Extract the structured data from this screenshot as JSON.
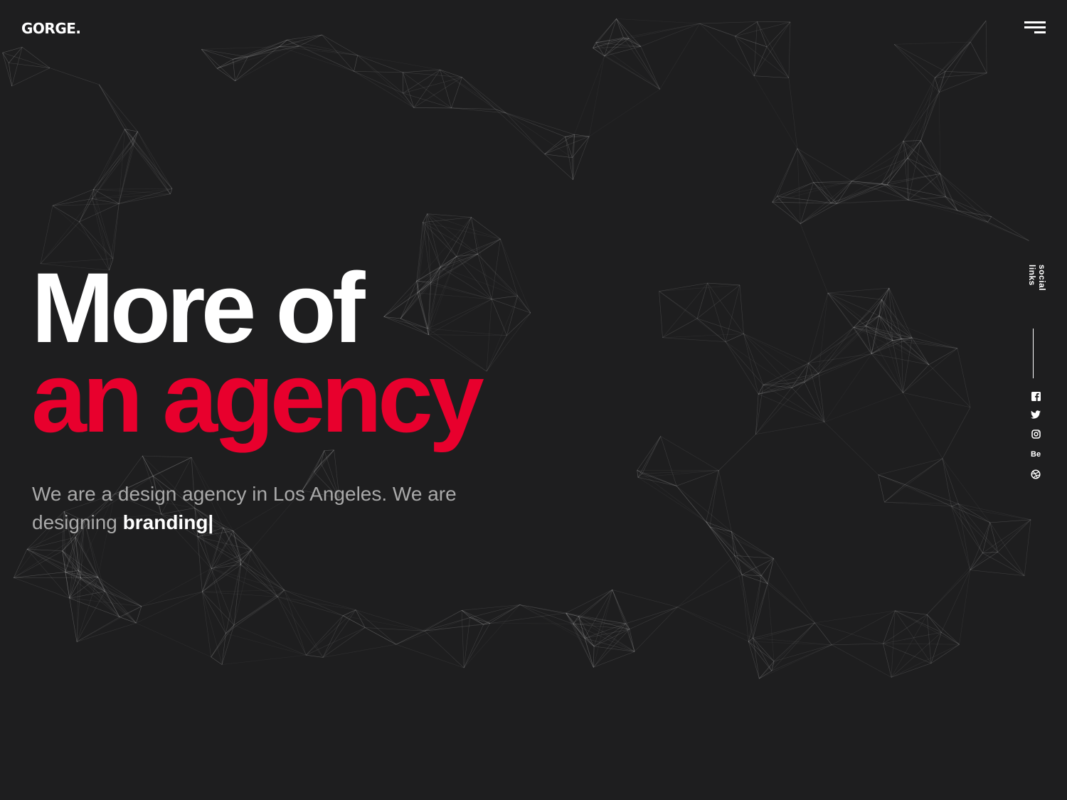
{
  "brand": {
    "logo": "GORGE."
  },
  "header": {
    "menu_icon": "hamburger-menu-icon"
  },
  "hero": {
    "line1": "More of",
    "line2": "an agency",
    "subtitle": "We are a design agency in Los Angeles. We are designing ",
    "typed_word": "branding|"
  },
  "social": {
    "label": "social links",
    "icons": [
      "facebook-icon",
      "twitter-icon",
      "instagram-icon",
      "behance-icon",
      "dribbble-icon"
    ]
  },
  "colors": {
    "background": "#1e1e1f",
    "accent": "#e8002d",
    "text": "#ffffff",
    "muted": "#a9a9a9"
  }
}
